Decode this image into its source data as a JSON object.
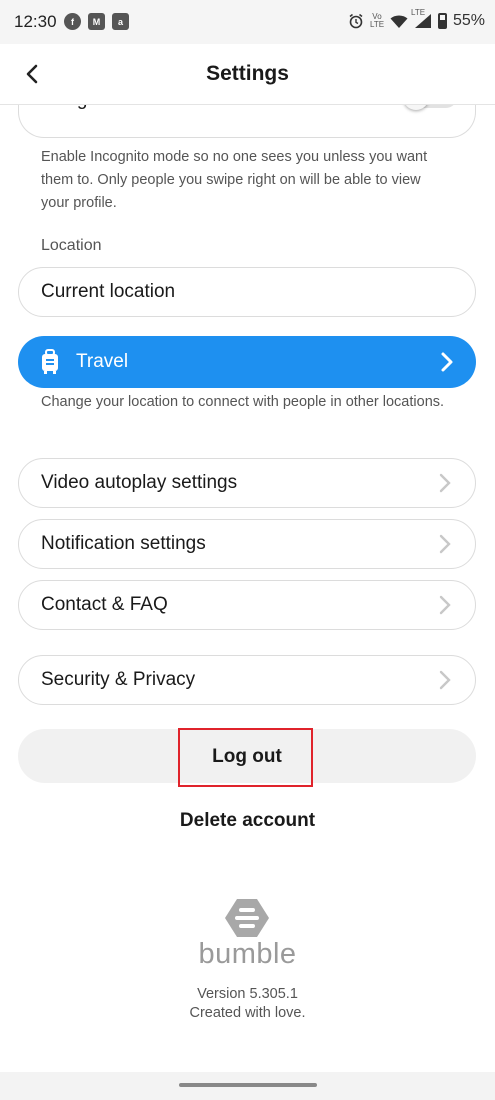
{
  "status_bar": {
    "time": "12:30",
    "left_icons": [
      "facebook-icon",
      "mpl-icon",
      "airtel-icon"
    ],
    "volte_label": "Vo LTE",
    "lte_label": "LTE",
    "battery": "55%"
  },
  "header": {
    "title": "Settings"
  },
  "incognito": {
    "label": "Incognito mode",
    "enabled": false,
    "description": "Enable Incognito mode so no one sees you unless you want them to. Only people you swipe right on will be able to view your profile."
  },
  "location": {
    "section_label": "Location",
    "current_label": "Current location",
    "travel_label": "Travel",
    "travel_description": "Change your location to connect with people in other locations."
  },
  "menu": {
    "video": "Video autoplay settings",
    "notifications": "Notification settings",
    "contact": "Contact & FAQ",
    "security": "Security & Privacy"
  },
  "account": {
    "logout": "Log out",
    "delete": "Delete account"
  },
  "footer": {
    "brand": "bumble",
    "version": "Version 5.305.1",
    "tagline": "Created with love."
  },
  "colors": {
    "travel_blue": "#1e90f0",
    "highlight_red": "#e0232b"
  }
}
